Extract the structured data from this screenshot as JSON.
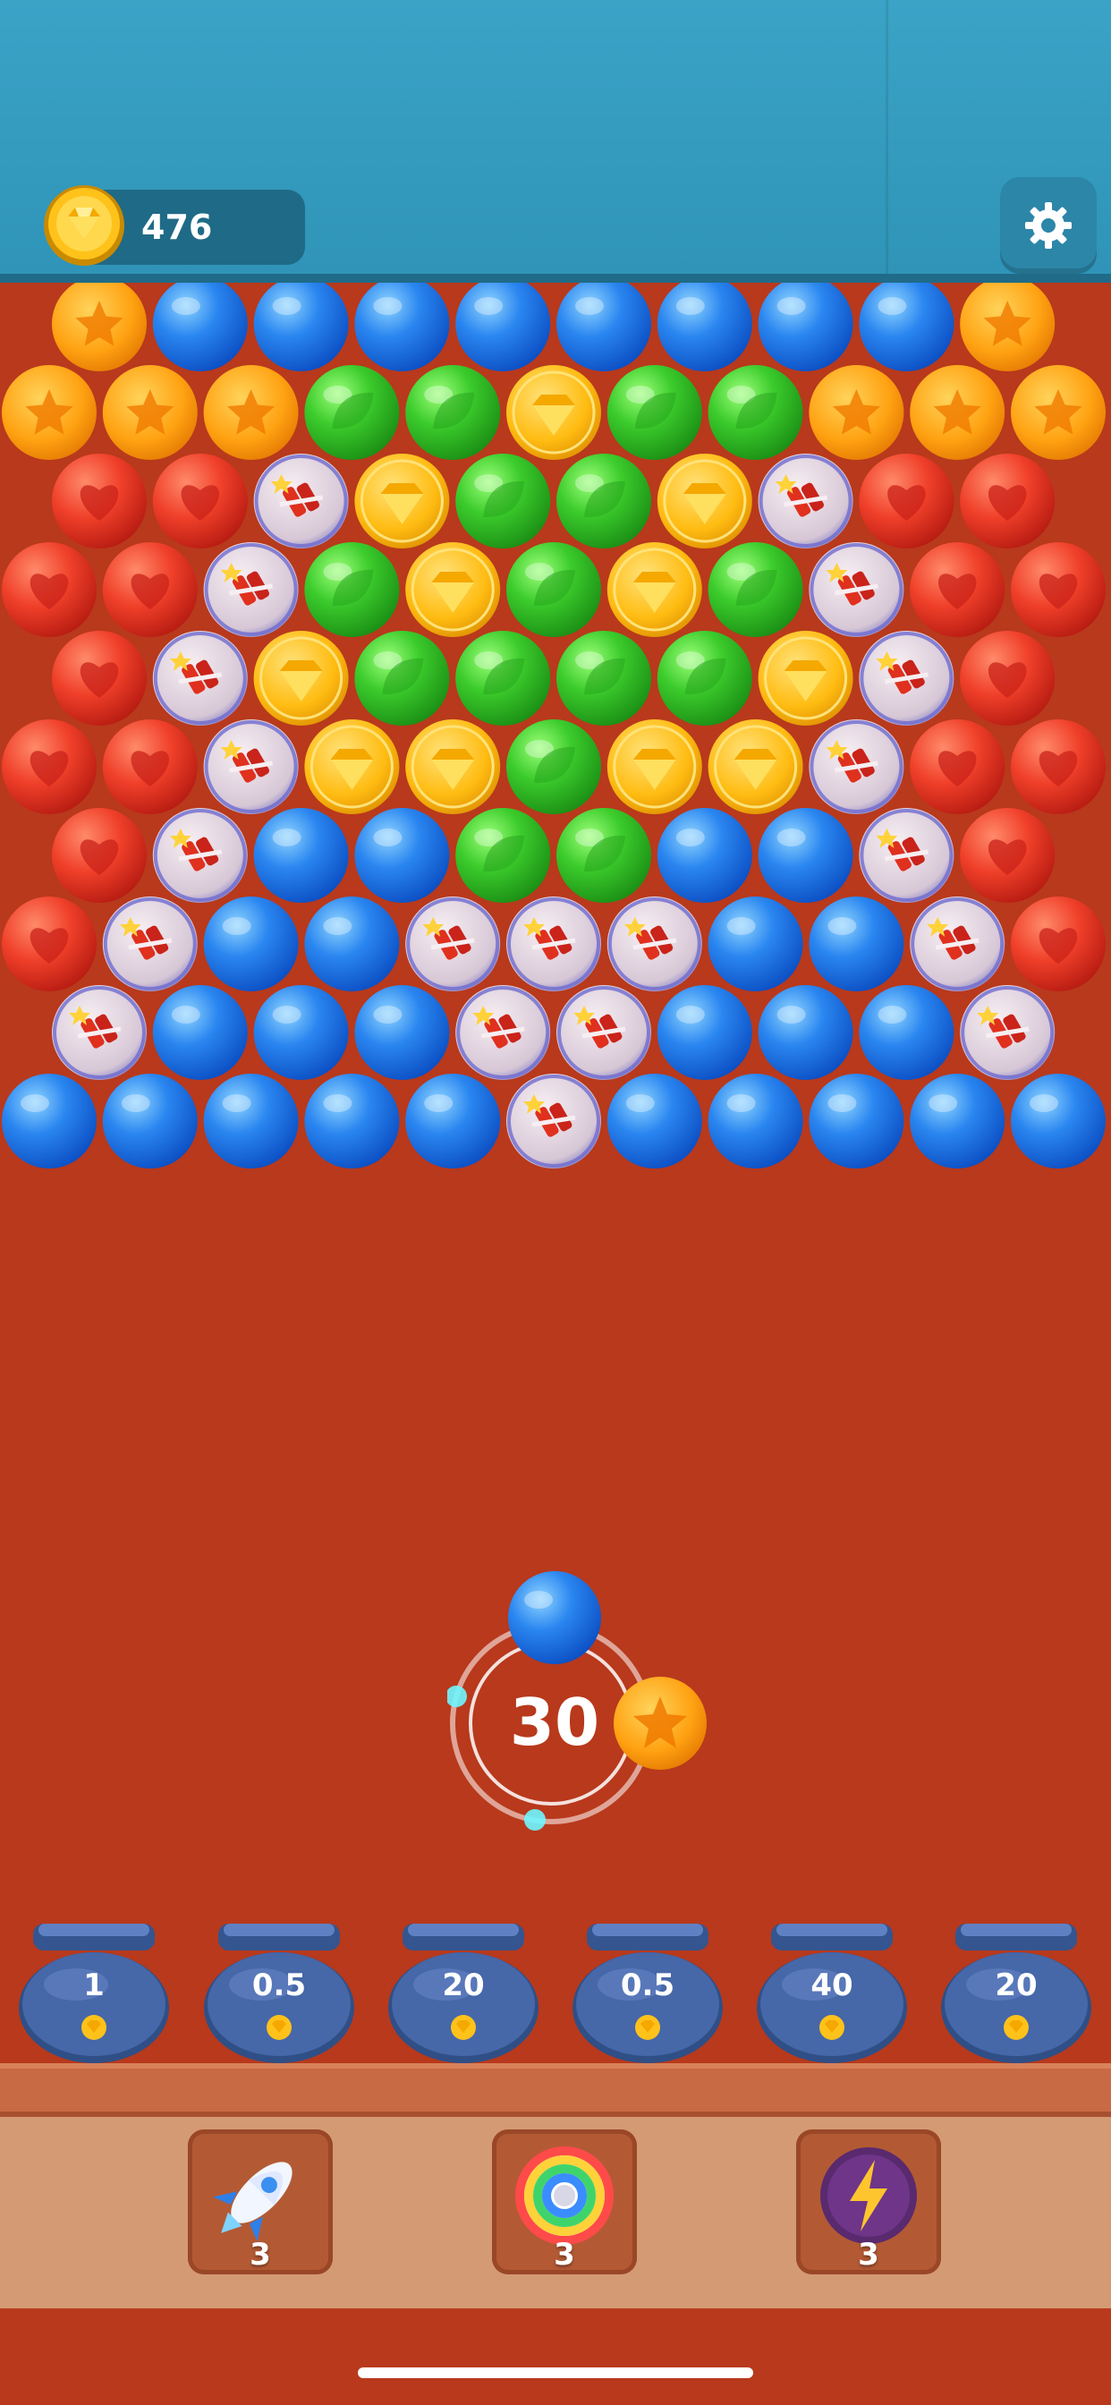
{
  "header": {
    "coins": "476",
    "coin_icon": "gold-gem-coin-icon",
    "settings_icon": "gear-icon"
  },
  "board": {
    "bubble_types": {
      "B": "blue-bubble",
      "G": "green-bubble",
      "Y": "gold-gem-bubble",
      "O": "orange-star-bubble",
      "R": "red-heart-bubble",
      "K": "firecracker-bubble"
    },
    "rows": [
      "OBBBBBBBBO",
      "OOOGGYGGOOO",
      "RRKYGGYKRR",
      "RRKGYGYGKRR",
      "RKYGGGGYKR",
      "RRKYYGYYKRR",
      "RKBBGGBBKR",
      "RKBBKKKBBKR",
      "KBBBKKBBBK",
      "BBBBBKBBBBB"
    ]
  },
  "shooter": {
    "shots_left": "30",
    "current_bubble": "blue-bubble",
    "next_bubble": "orange-star-bubble"
  },
  "pots": [
    {
      "label": "1"
    },
    {
      "label": "0.5"
    },
    {
      "label": "20"
    },
    {
      "label": "0.5"
    },
    {
      "label": "40"
    },
    {
      "label": "20"
    }
  ],
  "boosters": [
    {
      "icon": "rocket-icon",
      "count": "3"
    },
    {
      "icon": "rainbow-ball-icon",
      "count": "3"
    },
    {
      "icon": "lightning-ball-icon",
      "count": "3"
    }
  ]
}
